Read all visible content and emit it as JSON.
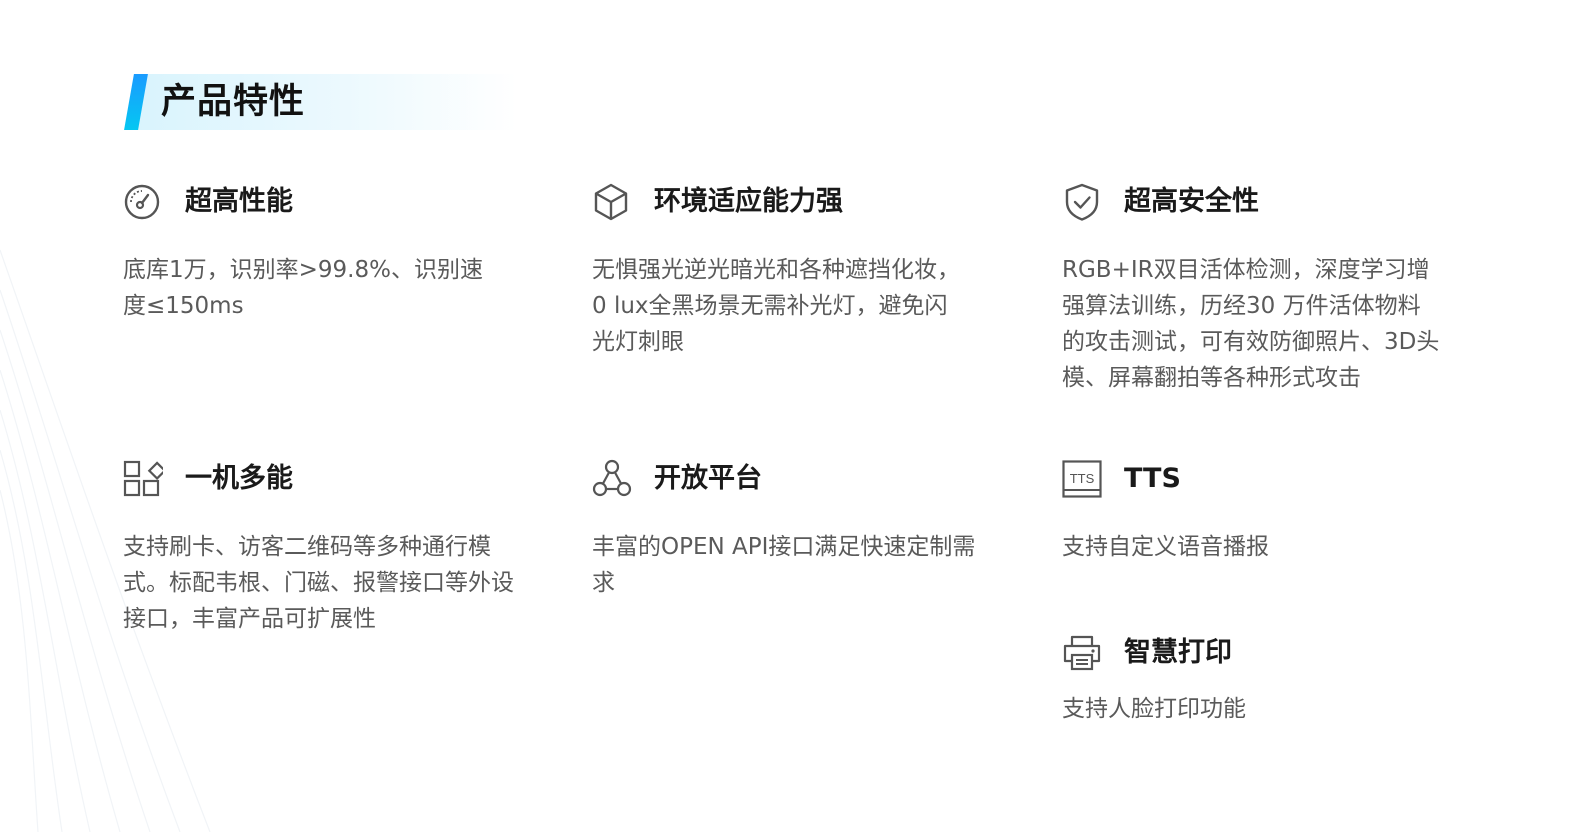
{
  "section": {
    "title": "产品特性"
  },
  "features": [
    {
      "icon": "speedometer-icon",
      "title": "超高性能",
      "desc": "底库1万，识别率>99.8%、识别速度≤150ms"
    },
    {
      "icon": "cube-icon",
      "title": "环境适应能力强",
      "desc": "无惧强光逆光暗光和各种遮挡化妆，0 lux全黑场景无需补光灯，避免闪光灯刺眼"
    },
    {
      "icon": "shield-check-icon",
      "title": "超高安全性",
      "desc": "RGB+IR双目活体检测，深度学习增强算法训练，历经30 万件活体物料的攻击测试，可有效防御照片、3D头模、屏幕翻拍等各种形式攻击"
    },
    {
      "icon": "grid-apps-icon",
      "title": "一机多能",
      "desc": "支持刷卡、访客二维码等多种通行模式。标配韦根、门磁、报警接口等外设接口，丰富产品可扩展性"
    },
    {
      "icon": "network-nodes-icon",
      "title": "开放平台",
      "desc": "丰富的OPEN API接口满足快速定制需求"
    },
    {
      "icon": "tts-box-icon",
      "icon_text": "TTS",
      "title": "TTS",
      "desc": "支持自定义语音播报"
    },
    {
      "icon": "printer-icon",
      "title": "智慧打印",
      "desc": "支持人脸打印功能"
    }
  ],
  "colors": {
    "accent": "#1a9bff",
    "icon": "#555555",
    "title": "#1a1a1a",
    "desc": "#5a5a5a"
  }
}
